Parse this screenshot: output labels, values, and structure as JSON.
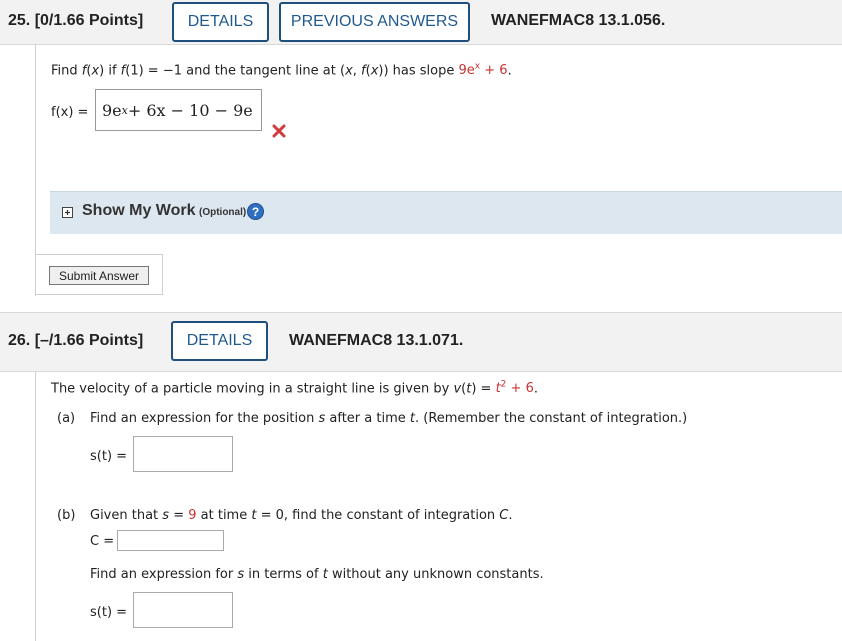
{
  "q25": {
    "number": "25.",
    "points": "[0/1.66 Points]",
    "details_label": "DETAILS",
    "prev_answers_label": "PREVIOUS ANSWERS",
    "code": "WANEFMAC8 13.1.056.",
    "prompt": {
      "p1": "Find ",
      "p2": "f",
      "p3": "(",
      "p4": "x",
      "p5": ") if ",
      "p6": "f",
      "p7": "(1) = −1 and the tangent line at (",
      "p8": "x",
      "p9": ", ",
      "p10": "f",
      "p11": "(",
      "p12": "x",
      "p13": ")) has slope ",
      "slope": "9e",
      "slope_exp": "x",
      "p14": " + ",
      "slope_const": "6",
      "p15": "."
    },
    "answer_label": "f(x) =",
    "answer_value": {
      "a": "9e",
      "a_exp": "x",
      "rest": " + 6x − 10 − 9e"
    },
    "status_icon": "incorrect-x-icon",
    "show_my_work": "Show My Work",
    "optional": "(Optional)",
    "submit_label": "Submit Answer"
  },
  "q26": {
    "number": "26.",
    "points": "[–/1.66 Points]",
    "details_label": "DETAILS",
    "code": "WANEFMAC8 13.1.071.",
    "prompt": {
      "p1": "The velocity of a particle moving in a straight line is given by ",
      "v": "v",
      "p2": "(",
      "t": "t",
      "p3": ") = ",
      "t2": "t",
      "exp": "2",
      "p4": " + ",
      "const": "6",
      "p5": "."
    },
    "part_a": {
      "label": "(a)",
      "text1": "Find an expression for the position ",
      "s": "s",
      "text2": " after a time ",
      "t": "t",
      "text3": ". (Remember the constant of integration.)",
      "answer_label": "s(t) =",
      "answer_value": ""
    },
    "part_b": {
      "label": "(b)",
      "text1": "Given that ",
      "s": "s",
      "text2": " = ",
      "s_val": "9",
      "text3": " at time ",
      "t": "t",
      "text4": " = 0, find the constant of integration ",
      "C": "C",
      "text5": ".",
      "c_label": "C =",
      "c_value": "",
      "text6": "Find an expression for ",
      "s2": "s",
      "text7": " in terms of ",
      "t2": "t",
      "text8": " without any unknown constants.",
      "answer_label": "s(t) =",
      "answer_value": ""
    }
  }
}
